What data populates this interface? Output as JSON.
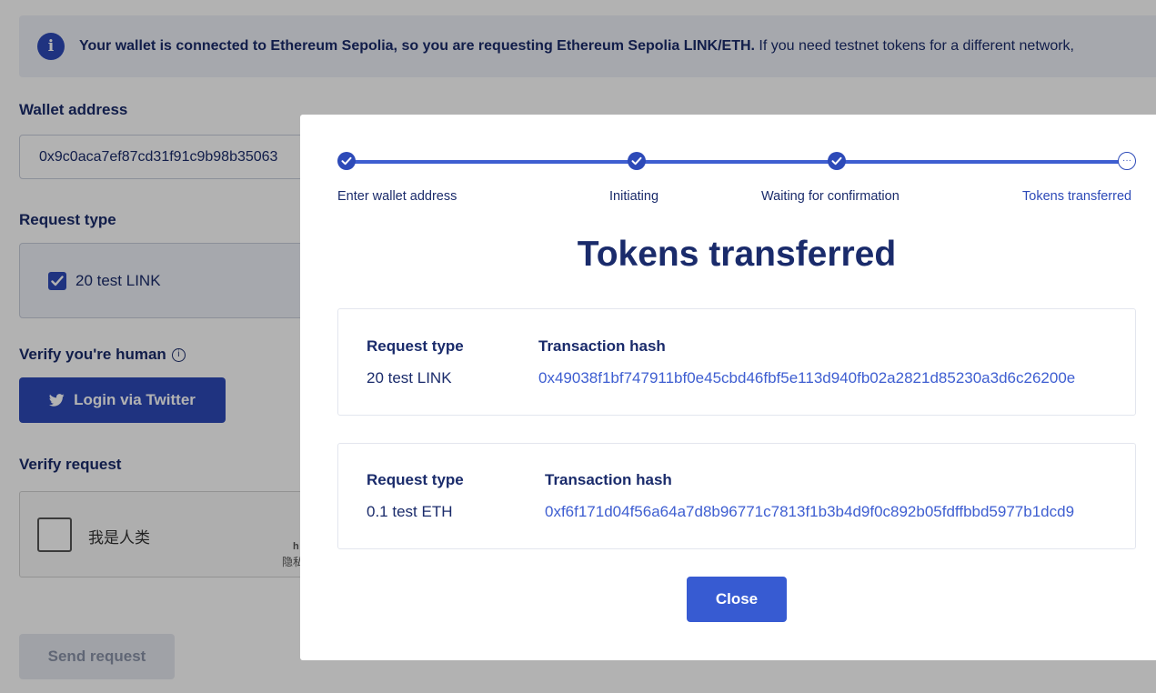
{
  "banner": {
    "bold_text": "Your wallet is connected to Ethereum Sepolia, so you are requesting Ethereum Sepolia LINK/ETH.",
    "text": " If you need testnet tokens for a different network,"
  },
  "form": {
    "wallet_label": "Wallet address",
    "wallet_value": "0x9c0aca7ef87cd31f91c9b98b35063",
    "request_type_label": "Request type",
    "request_option": "20 test LINK",
    "verify_human_label": "Verify you're human",
    "twitter_button": "Login via Twitter",
    "verify_request_label": "Verify request",
    "captcha_label": "我是人类",
    "captcha_h": "h",
    "captcha_privacy": "隐私",
    "send_button": "Send request"
  },
  "modal": {
    "steps": [
      {
        "label": "Enter wallet address",
        "done": true
      },
      {
        "label": "Initiating",
        "done": true
      },
      {
        "label": "Waiting for confirmation",
        "done": true
      },
      {
        "label": "Tokens transferred",
        "done": false
      }
    ],
    "pending_glyph": "···",
    "title": "Tokens transferred",
    "transactions": [
      {
        "type_header": "Request type",
        "type_value": "20 test LINK",
        "hash_header": "Transaction hash",
        "hash_value": "0x49038f1bf747911bf0e45cbd46fbf5e113d940fb02a2821d85230a3d6c26200e"
      },
      {
        "type_header": "Request type",
        "type_value": "0.1 test ETH",
        "hash_header": "Transaction hash",
        "hash_value": "0xf6f171d04f56a64a7d8b96771c7813f1b3b4d9f0c892b05fdffbbd5977b1dcd9"
      }
    ],
    "close_button": "Close"
  },
  "colors": {
    "primary": "#2d4ab8",
    "link": "#3e5ed1",
    "text_dark": "#1a2b6b"
  }
}
